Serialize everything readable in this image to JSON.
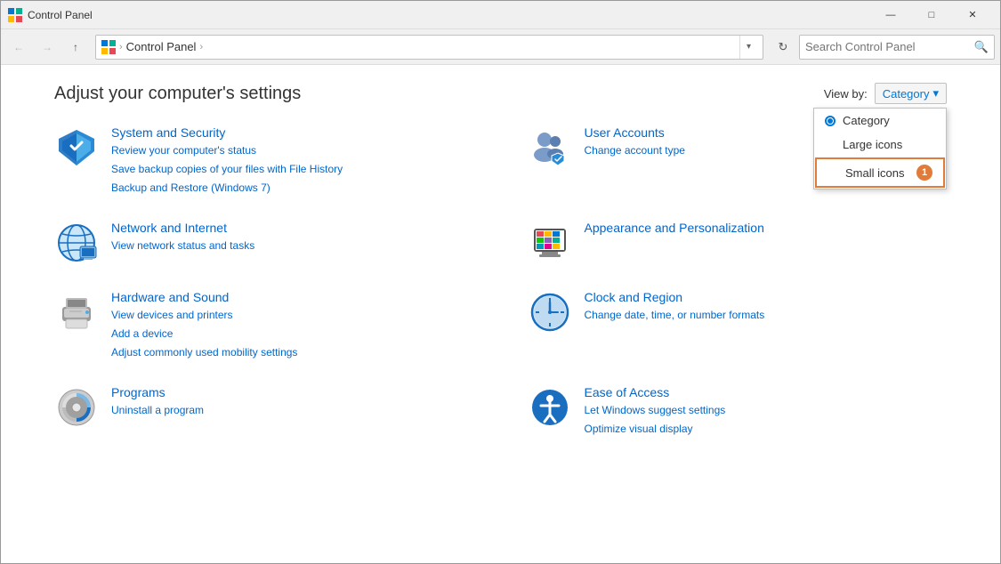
{
  "window": {
    "title": "Control Panel",
    "icon": "⊞"
  },
  "titlebar": {
    "title": "Control Panel",
    "minimize_label": "—",
    "maximize_label": "□",
    "close_label": "✕"
  },
  "navbar": {
    "back_tooltip": "Back",
    "forward_tooltip": "Forward",
    "up_tooltip": "Up",
    "address_items": [
      "Control Panel"
    ],
    "address_icon": "⊞",
    "dropdown_label": "▾",
    "refresh_label": "↻",
    "search_placeholder": "Search Control Panel",
    "search_icon": "🔍"
  },
  "main": {
    "page_title": "Adjust your computer's settings",
    "viewby_label": "View by:",
    "viewby_current": "Category",
    "viewby_dropdown_arrow": "▾",
    "dropdown_options": [
      {
        "id": "category",
        "label": "Category",
        "selected": true,
        "radio": true
      },
      {
        "id": "large-icons",
        "label": "Large icons",
        "selected": false,
        "radio": false
      },
      {
        "id": "small-icons",
        "label": "Small icons",
        "selected": false,
        "radio": false,
        "highlighted": true,
        "badge": "1"
      }
    ],
    "categories": [
      {
        "id": "system-security",
        "title": "System and Security",
        "links": [
          "Review your computer's status",
          "Save backup copies of your files with File History",
          "Backup and Restore (Windows 7)"
        ]
      },
      {
        "id": "user-accounts",
        "title": "User Accounts",
        "links": [
          "Change account type"
        ]
      },
      {
        "id": "network-internet",
        "title": "Network and Internet",
        "links": [
          "View network status and tasks"
        ]
      },
      {
        "id": "appearance-personalization",
        "title": "Appearance and Personalization",
        "links": []
      },
      {
        "id": "hardware-sound",
        "title": "Hardware and Sound",
        "links": [
          "View devices and printers",
          "Add a device",
          "Adjust commonly used mobility settings"
        ]
      },
      {
        "id": "clock-region",
        "title": "Clock and Region",
        "links": [
          "Change date, time, or number formats"
        ]
      },
      {
        "id": "programs",
        "title": "Programs",
        "links": [
          "Uninstall a program"
        ]
      },
      {
        "id": "ease-of-access",
        "title": "Ease of Access",
        "links": [
          "Let Windows suggest settings",
          "Optimize visual display"
        ]
      }
    ]
  }
}
